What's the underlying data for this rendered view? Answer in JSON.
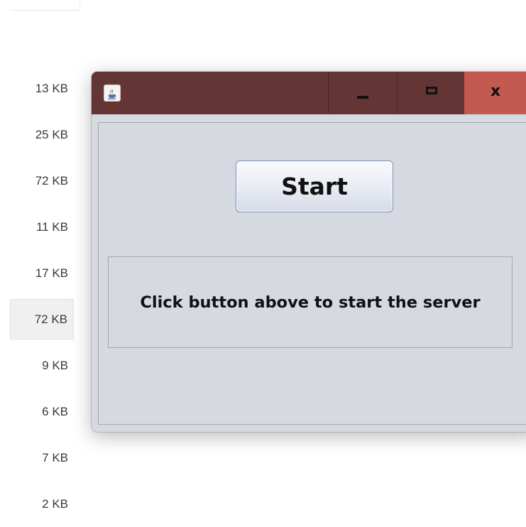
{
  "background": {
    "file_sizes": [
      "13 KB",
      "25 KB",
      "72 KB",
      "11 KB",
      "17 KB",
      "72 KB",
      "9 KB",
      "6 KB",
      "7 KB",
      "2 KB"
    ],
    "selected_row": "72 KB"
  },
  "window": {
    "title_icon": "java-cup-icon",
    "controls": {
      "minimize_icon": "minimize-icon",
      "maximize_icon": "maximize-icon",
      "close_label": "x"
    },
    "start_button_label": "Start",
    "status_message": "Click button above to start the server"
  },
  "colors": {
    "titlebar": "#643535",
    "close_button": "#c25a52",
    "window_body": "#d7d9e1"
  }
}
